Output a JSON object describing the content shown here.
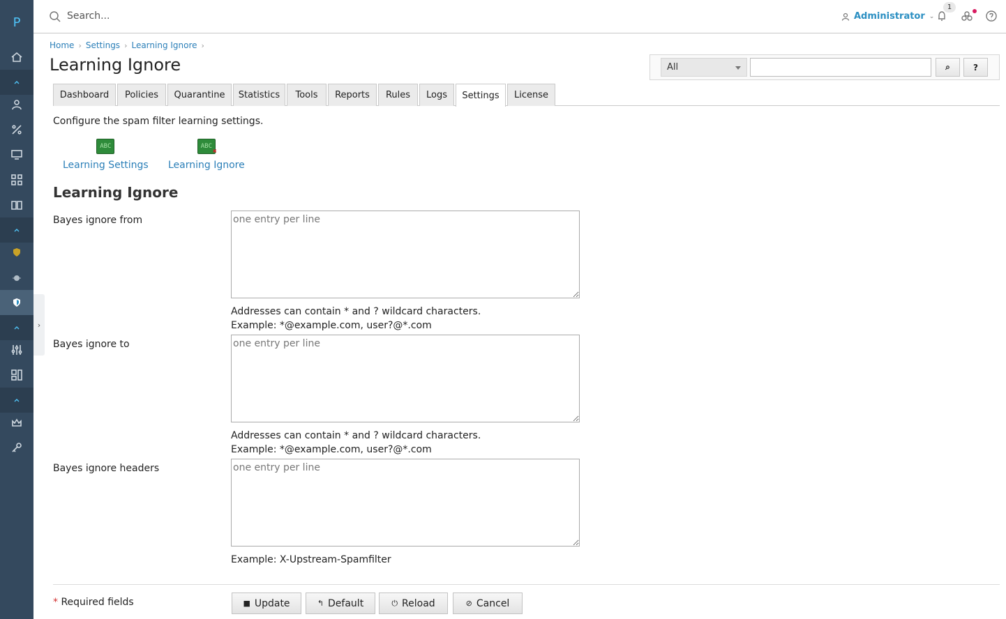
{
  "app": {
    "logo": "P"
  },
  "header": {
    "search_placeholder": "Search...",
    "user": "Administrator",
    "notifications_count": "1"
  },
  "breadcrumb": [
    "Home",
    "Settings",
    "Learning Ignore"
  ],
  "page_title": "Learning Ignore",
  "search_box": {
    "scope": "All",
    "search_button": "⌕",
    "help_button": "?"
  },
  "tabs": [
    "Dashboard",
    "Policies",
    "Quarantine",
    "Statistics",
    "Tools",
    "Reports",
    "Rules",
    "Logs",
    "Settings",
    "License"
  ],
  "active_tab": "Settings",
  "description": "Configure the spam filter learning settings.",
  "tools": [
    {
      "label": "Learning Settings",
      "icon_text": "ABC"
    },
    {
      "label": "Learning Ignore",
      "icon_text": "ABC"
    }
  ],
  "section_title": "Learning Ignore",
  "fields": [
    {
      "label": "Bayes ignore from",
      "placeholder": "one entry per line",
      "hint1": "Addresses can contain * and ? wildcard characters.",
      "hint2": "Example: *@example.com, user?@*.com"
    },
    {
      "label": "Bayes ignore to",
      "placeholder": "one entry per line",
      "hint1": "Addresses can contain * and ? wildcard characters.",
      "hint2": "Example: *@example.com, user?@*.com"
    },
    {
      "label": "Bayes ignore headers",
      "placeholder": "one entry per line",
      "hint1": "Example: X-Upstream-Spamfilter"
    }
  ],
  "footer": {
    "required_star": "*",
    "required_text": " Required fields",
    "buttons": {
      "update": "Update",
      "default": "Default",
      "reload": "Reload",
      "cancel": "Cancel"
    }
  },
  "colors": {
    "sidebar": "#34495e",
    "link": "#2b7fb8",
    "accent": "#2b8fc2"
  }
}
